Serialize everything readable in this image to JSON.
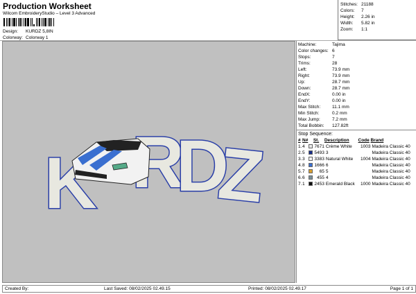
{
  "header": {
    "title": "Production Worksheet",
    "subtitle": "Wilcom EmbroideryStudio – Level 3 Advanced",
    "design_label": "Design:",
    "design_value": "KURDZ 5,8IN",
    "colorway_label": "Colorway:",
    "colorway_value": "Colorway 1"
  },
  "summary": [
    {
      "k": "Stitches:",
      "v": "21188"
    },
    {
      "k": "Colors:",
      "v": "7"
    },
    {
      "k": "Height:",
      "v": "2.26 in"
    },
    {
      "k": "Width:",
      "v": "5.82 in"
    },
    {
      "k": "Zoom:",
      "v": "1:1"
    }
  ],
  "stats": [
    {
      "k": "Machine:",
      "v": "Tajima"
    },
    {
      "k": "Color changes:",
      "v": "6"
    },
    {
      "k": "Stops:",
      "v": "7"
    },
    {
      "k": "Trims:",
      "v": "28"
    },
    {
      "k": "Left:",
      "v": "73.9 mm"
    },
    {
      "k": "Right:",
      "v": "73.9 mm"
    },
    {
      "k": "Up:",
      "v": "28.7 mm"
    },
    {
      "k": "Down:",
      "v": "28.7 mm"
    },
    {
      "k": "EndX:",
      "v": "0.00 in"
    },
    {
      "k": "EndY:",
      "v": "0.00 in"
    },
    {
      "k": "Max Stitch:",
      "v": "11.1 mm"
    },
    {
      "k": "Min Stitch:",
      "v": "0.2 mm"
    },
    {
      "k": "Max Jump:",
      "v": "7.2 mm"
    },
    {
      "k": "Total Bobbin:",
      "v": "127.82ft"
    }
  ],
  "sequence": {
    "title": "Stop Sequence:",
    "headers": [
      "#",
      "N#",
      "St.",
      "Description",
      "Code",
      "Brand"
    ],
    "rows": [
      {
        "n": "1.",
        "num": "4",
        "color": "#e8e8e8",
        "st": "7671",
        "desc": "Crème White",
        "code": "1003",
        "brand": "Madeira Classic 40"
      },
      {
        "n": "2.",
        "num": "5",
        "color": "#1a2f8a",
        "st": "5493",
        "desc": "3",
        "code": "",
        "brand": "Madeira Classic 40"
      },
      {
        "n": "3.",
        "num": "3",
        "color": "#f0f0f0",
        "st": "3383",
        "desc": "Natural White",
        "code": "1004",
        "brand": "Madeira Classic 40"
      },
      {
        "n": "4.",
        "num": "8",
        "color": "#3a6fd0",
        "st": "1666",
        "desc": "6",
        "code": "",
        "brand": "Madeira Classic 40"
      },
      {
        "n": "5.",
        "num": "7",
        "color": "#d9a030",
        "st": "65",
        "desc": "5",
        "code": "",
        "brand": "Madeira Classic 40"
      },
      {
        "n": "6.",
        "num": "6",
        "color": "#7a9098",
        "st": "455",
        "desc": "4",
        "code": "",
        "brand": "Madeira Classic 40"
      },
      {
        "n": "7.",
        "num": "1",
        "color": "#111111",
        "st": "2453",
        "desc": "Emerald Black",
        "code": "1000",
        "brand": "Madeira Classic 40"
      }
    ]
  },
  "design_art": {
    "letters": [
      "K",
      "R",
      "D",
      "Z"
    ]
  },
  "footer": {
    "created": "Created By:",
    "saved": "Last Saved: 08/02/2025 02.49.15",
    "printed": "Printed: 08/02/2025 02.49.17",
    "page": "Page 1 of 1"
  }
}
